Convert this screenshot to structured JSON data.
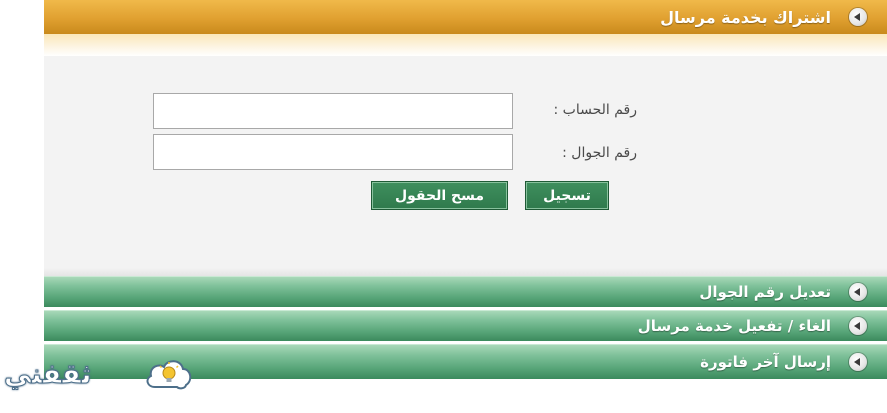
{
  "sections": {
    "subscribe": {
      "title": "اشتراك بخدمة مرسال"
    },
    "edit_mobile": {
      "title": "تعديل رقم الجوال"
    },
    "cancel_activate": {
      "title": "الغاء / تفعيل خدمة مرسال"
    },
    "send_last_bill": {
      "title": "إرسال آخر فاتورة"
    }
  },
  "form": {
    "account_label": "رقم الحساب :",
    "mobile_label": "رقم الجوال :",
    "account_value": "",
    "mobile_value": "",
    "register_label": "تسجيل",
    "clear_label": "مسح الحقول"
  },
  "watermark": {
    "text": "ثقفني"
  },
  "colors": {
    "active_header": "#e0a030",
    "inactive_header": "#56a477",
    "button": "#2f7a4c"
  },
  "icons": {
    "section_toggle": "circle-arrow-left-icon",
    "watermark_logo": "lightbulb-cloud-icon"
  }
}
